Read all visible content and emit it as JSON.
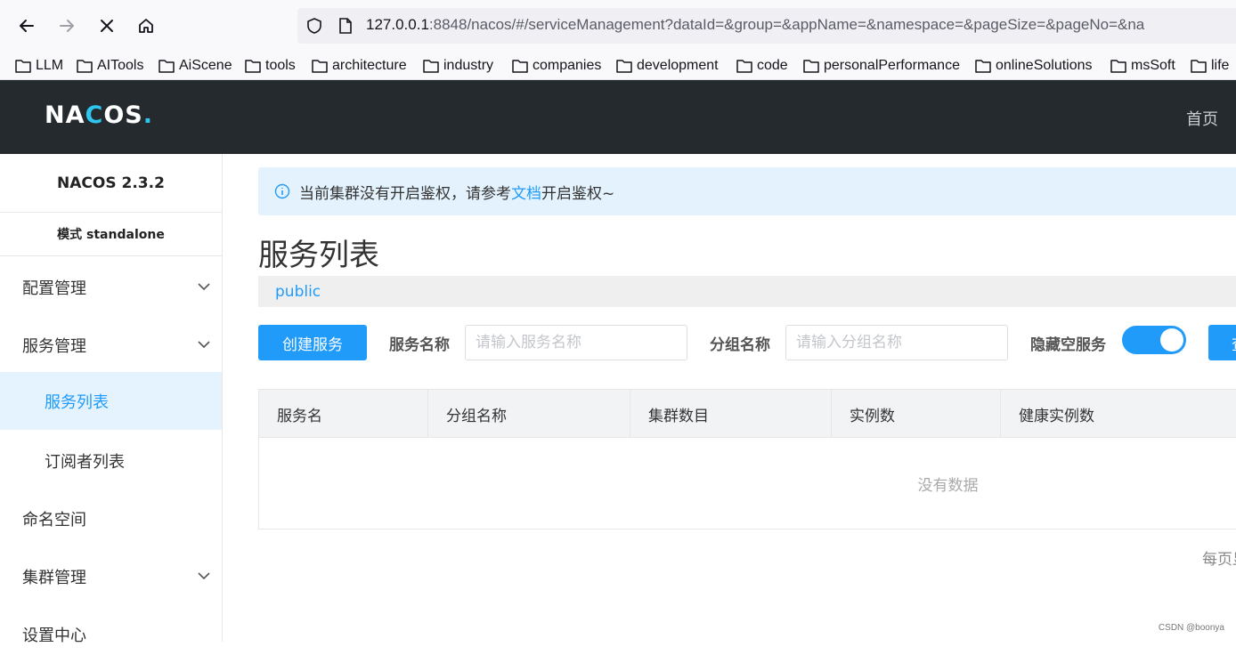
{
  "browser": {
    "url_host": "127.0.0.1",
    "url_rest": ":8848/nacos/#/serviceManagement?dataId=&group=&appName=&namespace=&pageSize=&pageNo=&na",
    "bookmarks": [
      "LLM",
      "AITools",
      "AiScene",
      "tools",
      "architecture",
      "industry",
      "companies",
      "development",
      "code",
      "personalPerformance",
      "onlineSolutions",
      "msSoft",
      "life"
    ]
  },
  "header": {
    "logo_pre": "NA",
    "logo_o": "C",
    "logo_post": "OS",
    "logo_dot": ".",
    "home_link": "首页"
  },
  "sidebar": {
    "version": "NACOS 2.3.2",
    "mode": "模式  standalone",
    "items": [
      {
        "label": "配置管理",
        "chevron": true
      },
      {
        "label": "服务管理",
        "chevron": true
      },
      {
        "label": "服务列表",
        "active": true
      },
      {
        "label": "订阅者列表"
      },
      {
        "label": "命名空间"
      },
      {
        "label": "集群管理",
        "chevron": true
      },
      {
        "label": "设置中心"
      }
    ]
  },
  "main": {
    "notice_prefix": "当前集群没有开启鉴权，请参考",
    "notice_link": "文档",
    "notice_suffix": "开启鉴权~",
    "title": "服务列表",
    "namespace": "public",
    "create_button": "创建服务",
    "service_name_label": "服务名称",
    "service_name_placeholder": "请输入服务名称",
    "group_name_label": "分组名称",
    "group_name_placeholder": "请输入分组名称",
    "hide_empty_label": "隐藏空服务",
    "hide_empty_on": true,
    "query_button": "查",
    "table": {
      "columns": [
        "服务名",
        "分组名称",
        "集群数目",
        "实例数",
        "健康实例数"
      ],
      "empty_text": "没有数据"
    },
    "per_page_label": "每页显"
  },
  "watermark": "CSDN @boonya",
  "colors": {
    "accent": "#209bfa",
    "header_bg": "#252a2f",
    "logo_accent": "#2ec6ee"
  }
}
